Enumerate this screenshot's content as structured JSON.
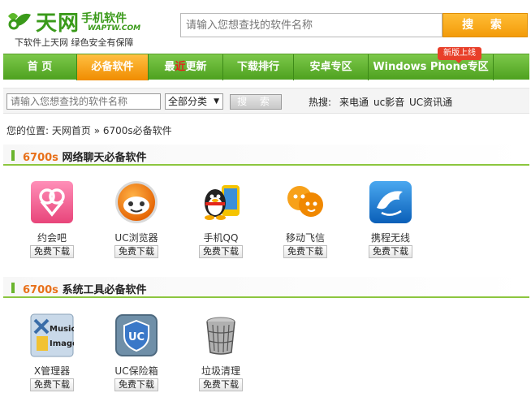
{
  "header": {
    "logo_title": "天网",
    "logo_subtitle": "手机软件",
    "logo_domain": "WAPTW.COM",
    "logo_slogan": "下软件上天网  绿色安全有保障",
    "search_placeholder": "请输入您想查找的软件名称",
    "search_button": "搜 索",
    "brand_color": "#3a9a1a",
    "accent_color": "#f39b0a"
  },
  "nav": {
    "items": [
      {
        "label": "首 页"
      },
      {
        "label": "必备软件",
        "active": true
      },
      {
        "label_prefix": "最",
        "label_highlight": "近",
        "label_suffix": "更新"
      },
      {
        "label": "下载排行"
      },
      {
        "label": "安卓专区"
      },
      {
        "label": "Windows Phone专区"
      }
    ],
    "badge": "新版上线",
    "nav_color": "#5cae2a"
  },
  "search2": {
    "placeholder": "请输入您想查找的软件名称",
    "category_selected": "全部分类",
    "button": "搜 索",
    "hot_label": "热搜:",
    "hot_items": [
      "来电通",
      "uc影音",
      "UC资讯通"
    ]
  },
  "breadcrumb": {
    "prefix": "您的位置:",
    "home": "天网首页",
    "separator": "»",
    "current": "6700s必备软件"
  },
  "sections": [
    {
      "model": "6700s",
      "title": " 网络聊天必备软件",
      "apps": [
        {
          "name": "约会吧",
          "download": "免费下载",
          "icon": "dating-app-icon"
        },
        {
          "name": "UC浏览器",
          "download": "免费下载",
          "icon": "uc-browser-icon"
        },
        {
          "name": "手机QQ",
          "download": "免费下载",
          "icon": "qq-penguin-icon"
        },
        {
          "name": "移动飞信",
          "download": "免费下载",
          "icon": "fetion-icon"
        },
        {
          "name": "携程无线",
          "download": "免费下载",
          "icon": "ctrip-dolphin-icon"
        }
      ]
    },
    {
      "model": "6700s",
      "title": " 系统工具必备软件",
      "apps": [
        {
          "name": "X管理器",
          "download": "免费下载",
          "icon": "x-plore-icon",
          "icon_text": [
            "Music",
            "Images"
          ]
        },
        {
          "name": "UC保险箱",
          "download": "免费下载",
          "icon": "uc-safe-icon",
          "icon_text": [
            "UC"
          ]
        },
        {
          "name": "垃圾清理",
          "download": "免费下载",
          "icon": "trash-bin-icon"
        }
      ]
    }
  ]
}
